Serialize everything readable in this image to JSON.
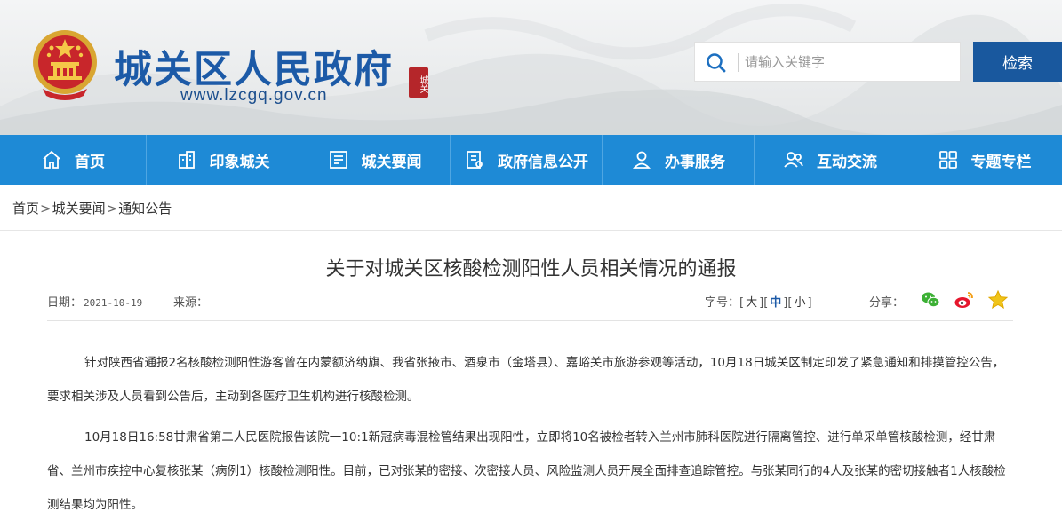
{
  "header": {
    "site_title": "城关区人民政府",
    "seal_text": "城关",
    "site_url": "www.lzcgq.gov.cn",
    "search_placeholder": "请输入关键字",
    "search_button": "检索"
  },
  "nav": {
    "items": [
      {
        "label": "首页",
        "icon": "home-icon"
      },
      {
        "label": "印象城关",
        "icon": "building-icon"
      },
      {
        "label": "城关要闻",
        "icon": "newspaper-icon"
      },
      {
        "label": "政府信息公开",
        "icon": "document-icon"
      },
      {
        "label": "办事服务",
        "icon": "user-icon"
      },
      {
        "label": "互动交流",
        "icon": "users-icon"
      },
      {
        "label": "专题专栏",
        "icon": "grid-icon"
      }
    ]
  },
  "breadcrumb": {
    "items": [
      "首页",
      "城关要闻",
      "通知公告"
    ],
    "separator": ">"
  },
  "article": {
    "title": "关于对城关区核酸检测阳性人员相关情况的通报",
    "date_label": "日期：",
    "date": "2021-10-19",
    "source_label": "来源：",
    "font_size_label": "字号：",
    "font_sizes": [
      "大",
      "中",
      "小"
    ],
    "share_label": "分享：",
    "share_icons": [
      "wechat-icon",
      "weibo-icon",
      "favorite-icon"
    ],
    "paragraphs": [
      "针对陕西省通报2名核酸检测阳性游客曾在内蒙额济纳旗、我省张掖市、酒泉市（金塔县）、嘉峪关市旅游参观等活动，10月18日城关区制定印发了紧急通知和排摸管控公告，要求相关涉及人员看到公告后，主动到各医疗卫生机构进行核酸检测。",
      "10月18日16:58甘肃省第二人民医院报告该院一10:1新冠病毒混检管结果出现阳性，立即将10名被检者转入兰州市肺科医院进行隔离管控、进行单采单管核酸检测，经甘肃省、兰州市疾控中心复核张某（病例1）核酸检测阳性。目前，已对张某的密接、次密接人员、风险监测人员开展全面排查追踪管控。与张某同行的4人及张某的密切接触者1人核酸检测结果均为阳性。"
    ]
  },
  "colors": {
    "brand_blue": "#1c5aa7",
    "nav_blue": "#1e8ad6",
    "button_blue": "#19589e",
    "seal_red": "#b5262a"
  }
}
